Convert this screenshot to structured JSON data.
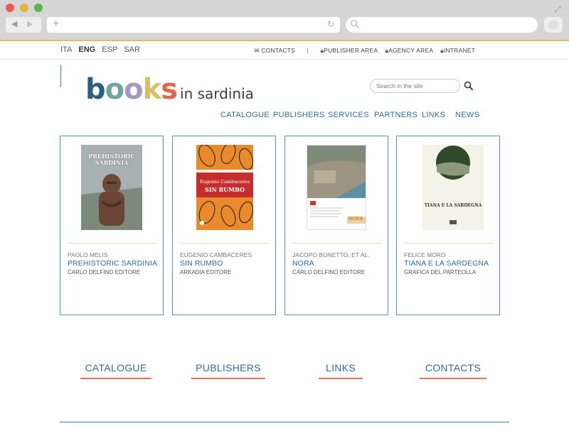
{
  "colors": {
    "accent": "#2e6c9e",
    "underline": "#e8705b",
    "gold": "#e6b95a",
    "card_border": "#5d8fbd"
  },
  "languages": [
    {
      "label": "ITA",
      "active": false
    },
    {
      "label": "ENG",
      "active": true
    },
    {
      "label": "ESP",
      "active": false
    },
    {
      "label": "SAR",
      "active": false
    }
  ],
  "utility_links": {
    "contacts": "CONTACTS",
    "separator": "|",
    "publisher_area": "PUBLISHER AREA",
    "agency_area": "AGENCY AREA",
    "intranet": "INTRANET"
  },
  "logo": {
    "letters": [
      {
        "char": "b",
        "color": "#2b5f86"
      },
      {
        "char": "o",
        "color": "#6fa3a0"
      },
      {
        "char": "o",
        "color": "#a29ac0"
      },
      {
        "char": "k",
        "color": "#d9c066"
      },
      {
        "char": "s",
        "color": "#e0674e"
      }
    ],
    "suffix": "in sardinia"
  },
  "search": {
    "placeholder": "Search in the site"
  },
  "main_nav": [
    "CATALOGUE",
    "PUBLISHERS",
    "SERVICES",
    "PARTNERS",
    "LINKS",
    "NEWS"
  ],
  "books": [
    {
      "author": "PAOLO MELIS",
      "title": "PREHISTORIC SARDINIA",
      "publisher": "CARLO DELFINO EDITORE",
      "cover_text": "PREHISTORIC SARDINIA"
    },
    {
      "author": "EUGENIO CAMBACERES",
      "title": "SIN RUMBO",
      "publisher": "ARKADIA EDITORE",
      "cover_text": "SIN RUMBO",
      "cover_author": "Eugenio Cambaceres"
    },
    {
      "author": "JACOPO BONETTO, ET AL.",
      "title": "NORA",
      "publisher": "CARLO DELFINO EDITORE",
      "cover_text": "NORA"
    },
    {
      "author": "FELICE MORO",
      "title": "TIANA E LA SARDEGNA",
      "publisher": "GRAFICA DEL PARTEOLLA",
      "cover_text": "TIANA E LA SARDEGNA"
    }
  ],
  "footer_links": [
    "CATALOGUE",
    "PUBLISHERS",
    "LINKS",
    "CONTACTS"
  ]
}
